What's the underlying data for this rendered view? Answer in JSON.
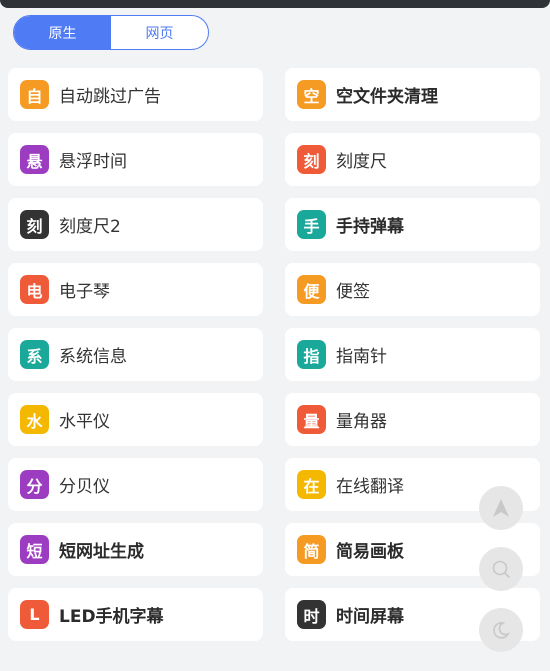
{
  "tabs": [
    {
      "label": "原生",
      "active": true
    },
    {
      "label": "网页",
      "active": false
    }
  ],
  "tools": [
    {
      "icon": "自",
      "label": "自动跳过广告",
      "color": "#f59a23",
      "bold": false
    },
    {
      "icon": "空",
      "label": "空文件夹清理",
      "color": "#f59a23",
      "bold": true
    },
    {
      "icon": "悬",
      "label": "悬浮时间",
      "color": "#9c3cc0",
      "bold": false
    },
    {
      "icon": "刻",
      "label": "刻度尺",
      "color": "#ef5b39",
      "bold": false
    },
    {
      "icon": "刻",
      "label": "刻度尺2",
      "color": "#333333",
      "bold": false
    },
    {
      "icon": "手",
      "label": "手持弹幕",
      "color": "#1aa89a",
      "bold": true
    },
    {
      "icon": "电",
      "label": "电子琴",
      "color": "#ef5b39",
      "bold": false
    },
    {
      "icon": "便",
      "label": "便签",
      "color": "#f59a23",
      "bold": false
    },
    {
      "icon": "系",
      "label": "系统信息",
      "color": "#1aa89a",
      "bold": false
    },
    {
      "icon": "指",
      "label": "指南针",
      "color": "#1aa89a",
      "bold": false
    },
    {
      "icon": "水",
      "label": "水平仪",
      "color": "#f5b800",
      "bold": false
    },
    {
      "icon": "量",
      "label": "量角器",
      "color": "#ef5b39",
      "bold": false
    },
    {
      "icon": "分",
      "label": "分贝仪",
      "color": "#9c3cc0",
      "bold": false
    },
    {
      "icon": "在",
      "label": "在线翻译",
      "color": "#f5b800",
      "bold": false
    },
    {
      "icon": "短",
      "label": "短网址生成",
      "color": "#9c3cc0",
      "bold": true
    },
    {
      "icon": "简",
      "label": "简易画板",
      "color": "#f59a23",
      "bold": true
    },
    {
      "icon": "L",
      "label": "LED手机字幕",
      "color": "#ef5b39",
      "bold": true
    },
    {
      "icon": "时",
      "label": "时间屏幕",
      "color": "#333333",
      "bold": true
    }
  ],
  "fabs": [
    {
      "name": "scroll-top-icon"
    },
    {
      "name": "search-icon"
    },
    {
      "name": "night-mode-icon"
    }
  ]
}
